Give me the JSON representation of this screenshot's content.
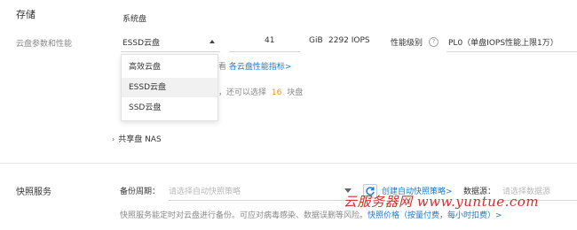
{
  "storage": {
    "section_title": "存储",
    "section_sub": "云盘参数和性能",
    "system_disk_label": "系统盘",
    "disk_type_selected": "ESSD云盘",
    "disk_size": "41",
    "disk_unit": "GiB",
    "iops": "2292 IOPS",
    "perf_label": "性能级别",
    "perf_value": "PL0（单盘IOPS性能上限1万）",
    "dropdown_options": [
      "高效云盘",
      "ESSD云盘",
      "SSD云盘"
    ],
    "hint_link_prefix": "看",
    "hint_link": "各云盘性能指标>",
    "hint_quota_prefix": "，还可以选择",
    "hint_quota_count": "16",
    "hint_quota_suffix": "块盘",
    "nas_label": "共享盘 NAS"
  },
  "snapshot": {
    "section_title": "快照服务",
    "backup_label": "备份周期：",
    "backup_placeholder": "请选择自动快照策略",
    "create_link": "创建自动快照策略>",
    "source_label": "数据源：",
    "source_placeholder": "请选择数据源",
    "desc_prefix": "快照服务能定时对云盘进行备份。可应对病毒感染、数据误删等风险。",
    "desc_link": "快照价格（按量付费，每小时扣费）>"
  },
  "watermark": "云服务器网 www.yuntue.com"
}
